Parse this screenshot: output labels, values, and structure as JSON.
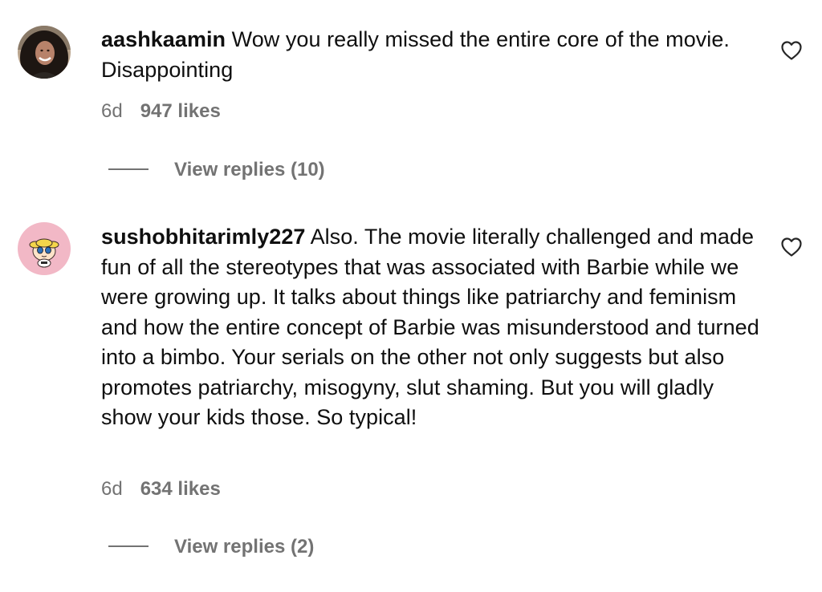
{
  "comments": [
    {
      "username": "aashkaamin",
      "text": "Wow you really missed the entire core of the movie. Disappointing",
      "time": "6d",
      "likes": "947 likes",
      "replies": "View replies (10)",
      "avatar_icon": "user-photo-avatar"
    },
    {
      "username": "sushobhitarimly227",
      "text": "Also. The movie literally challenged and made fun of all the stereotypes that was associated with Barbie while we were growing up. It talks about things like patriarchy and feminism and how the entire concept of Barbie was misunderstood and turned into a bimbo. Your serials on the other not only suggests but also promotes patriarchy, misogyny, slut shaming. But you will gladly show your kids those. So typical!",
      "time": "6d",
      "likes": "634 likes",
      "replies": "View replies (2)",
      "avatar_icon": "cartoon-character-avatar"
    }
  ],
  "colors": {
    "text": "#0f0f0f",
    "secondary": "#737373",
    "avatar2_bg": "#f2b8c6"
  }
}
